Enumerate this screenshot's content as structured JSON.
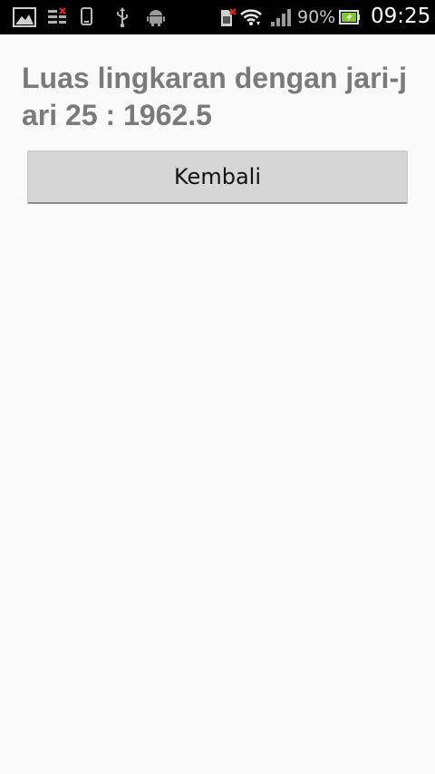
{
  "status_bar": {
    "icons_left": [
      "gallery-icon",
      "sync-error-icon",
      "phone-icon",
      "usb-icon",
      "android-debug-icon"
    ],
    "icons_right": [
      "sim-error-icon",
      "wifi-icon",
      "signal-icon",
      "battery-charging-icon"
    ],
    "battery_percent": "90%",
    "time": "09:25"
  },
  "main": {
    "result_text": "Luas lingkaran dengan jari-jari 25 : 1962.5",
    "back_button_label": "Kembali"
  },
  "colors": {
    "status_bar_bg": "#000000",
    "background": "#fafafa",
    "result_text": "#7a7a7a",
    "button_bg": "#d6d6d6",
    "battery_fill": "#7ec832"
  }
}
